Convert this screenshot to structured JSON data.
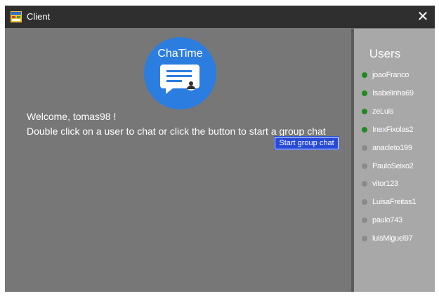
{
  "window": {
    "title": "Client",
    "close_symbol": "✕"
  },
  "logo": {
    "text": "ChaTime"
  },
  "main": {
    "welcome": "Welcome, tomas98 !",
    "instructions": "Double click on a user to chat or click the button to start a group chat",
    "group_button": "Start group chat"
  },
  "users": {
    "title": "Users",
    "items": [
      {
        "name": "joaoFranco",
        "status": "online"
      },
      {
        "name": "Isabelinha69",
        "status": "online"
      },
      {
        "name": "zeLuis",
        "status": "online"
      },
      {
        "name": "InexFixolas2",
        "status": "online"
      },
      {
        "name": "anacleto199",
        "status": "offline"
      },
      {
        "name": "PauloSeixo2",
        "status": "offline"
      },
      {
        "name": "vitor123",
        "status": "offline"
      },
      {
        "name": "LuisaFreitas1",
        "status": "offline"
      },
      {
        "name": "paulo743",
        "status": "offline"
      },
      {
        "name": "luisMiguel97",
        "status": "offline"
      }
    ]
  },
  "colors": {
    "titlebar": "#2f2f2f",
    "main_bg": "#777777",
    "users_bg": "#a8a8a8",
    "logo_circle": "#2b7de0",
    "button": "#2649d6",
    "online": "#1f8a1f",
    "offline": "#8a8a8a"
  }
}
